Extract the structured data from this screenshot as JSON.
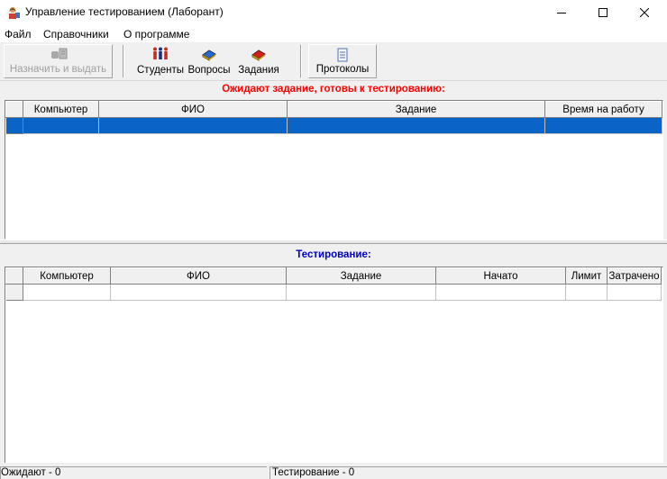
{
  "window": {
    "title": "Управление тестированием (Лаборант)",
    "colors": {
      "title_bar": "#ffffff",
      "selection": "#0a64c8",
      "red_heading": "#ff0000",
      "blue_heading": "#0000c0"
    }
  },
  "menu": [
    "Файл",
    "Справочники",
    "О программе"
  ],
  "toolbar": {
    "assign_label": "Назначить и выдать",
    "students_label": "Студенты",
    "questions_label": "Вопросы",
    "tasks_label": "Задания",
    "protocols_label": "Протоколы"
  },
  "waiting": {
    "heading": "Ожидают задание, готовы к тестированию:",
    "columns": [
      "Компьютер",
      "ФИО",
      "Задание",
      "Время на работу"
    ]
  },
  "testing": {
    "heading": "Тестирование:",
    "columns": [
      "Компьютер",
      "ФИО",
      "Задание",
      "Начато",
      "Лимит",
      "Затрачено"
    ]
  },
  "status": {
    "waiting": "Ожидают - 0",
    "testing": "Тестирование - 0"
  },
  "icons": [
    "app-icon",
    "minimize-icon",
    "maximize-icon",
    "close-icon",
    "assign-icon",
    "students-icon",
    "questions-icon",
    "tasks-icon",
    "protocols-icon"
  ]
}
